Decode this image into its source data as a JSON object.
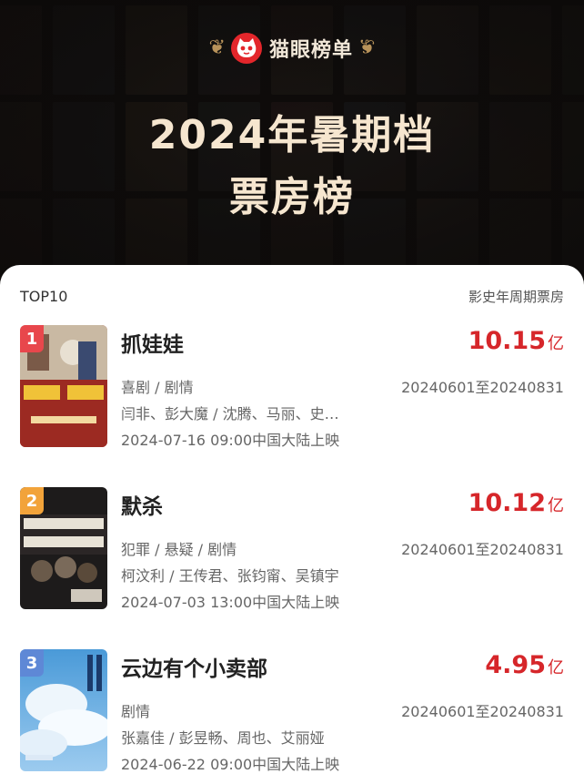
{
  "brand": {
    "name": "猫眼榜单",
    "logo_icon": "maoyan-cat-logo-icon",
    "laurel_icon": "laurel-icon"
  },
  "title": {
    "line1": "2024年暑期档",
    "line2": "票房榜"
  },
  "list_header": {
    "left": "TOP10",
    "right": "影史年周期票房"
  },
  "colors": {
    "accent_red": "#d6262a",
    "rank1": "#e8474c",
    "rank2": "#f2a33a",
    "rank3": "#5e88d6"
  },
  "movies": [
    {
      "rank": "1",
      "title": "抓娃娃",
      "box_office": "10.15",
      "unit": "亿",
      "genre": "喜剧 / 剧情",
      "cast": "闫非、彭大魔 / 沈腾、马丽、史…",
      "release": "2024-07-16 09:00中国大陆上映",
      "period": "20240601至20240831"
    },
    {
      "rank": "2",
      "title": "默杀",
      "box_office": "10.12",
      "unit": "亿",
      "genre": "犯罪 / 悬疑 / 剧情",
      "cast": "柯汶利 / 王传君、张钧甯、吴镇宇",
      "release": "2024-07-03 13:00中国大陆上映",
      "period": "20240601至20240831"
    },
    {
      "rank": "3",
      "title": "云边有个小卖部",
      "box_office": "4.95",
      "unit": "亿",
      "genre": "剧情",
      "cast": "张嘉佳 / 彭昱畅、周也、艾丽娅",
      "release": "2024-06-22 09:00中国大陆上映",
      "period": "20240601至20240831"
    }
  ]
}
